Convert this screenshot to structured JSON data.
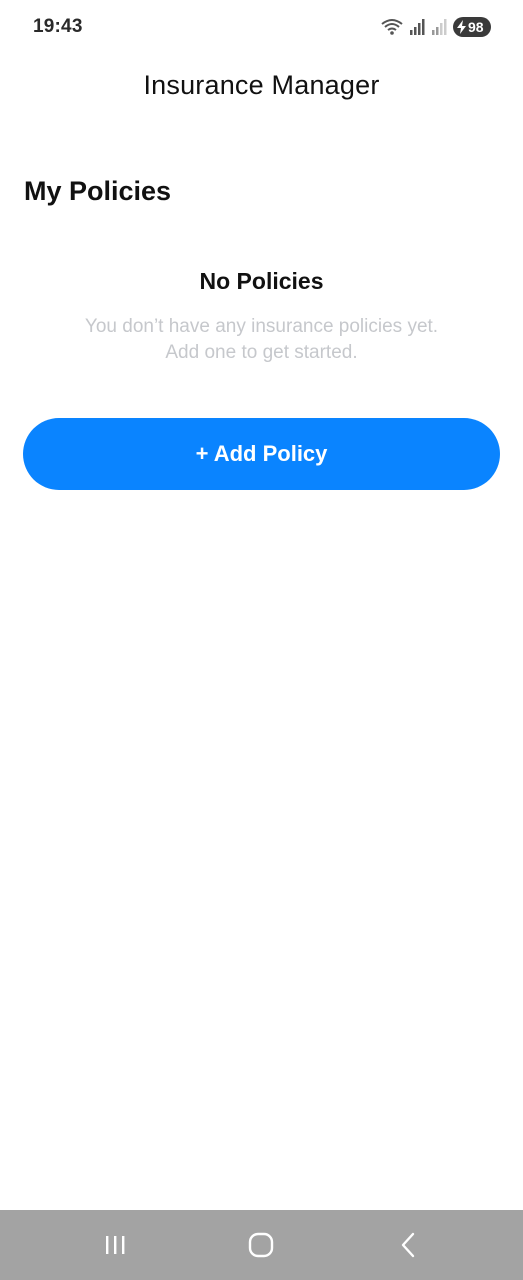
{
  "status_bar": {
    "time": "19:43",
    "battery_level": "98",
    "icons": [
      "wifi-icon",
      "signal-icon",
      "signal-weak-icon",
      "battery-charging-icon"
    ]
  },
  "header": {
    "title": "Insurance Manager"
  },
  "policies": {
    "section_title": "My Policies",
    "empty_title": "No Policies",
    "empty_line1": "You don’t have any insurance policies yet.",
    "empty_line2": "Add one to get started.",
    "add_button_label": "+ Add Policy"
  },
  "colors": {
    "accent": "#0a84ff",
    "muted_text": "#c6c8cc",
    "nav_bar": "#a3a3a3"
  },
  "nav_bar": {
    "buttons": [
      "recent-apps-icon",
      "home-icon",
      "back-icon"
    ]
  }
}
